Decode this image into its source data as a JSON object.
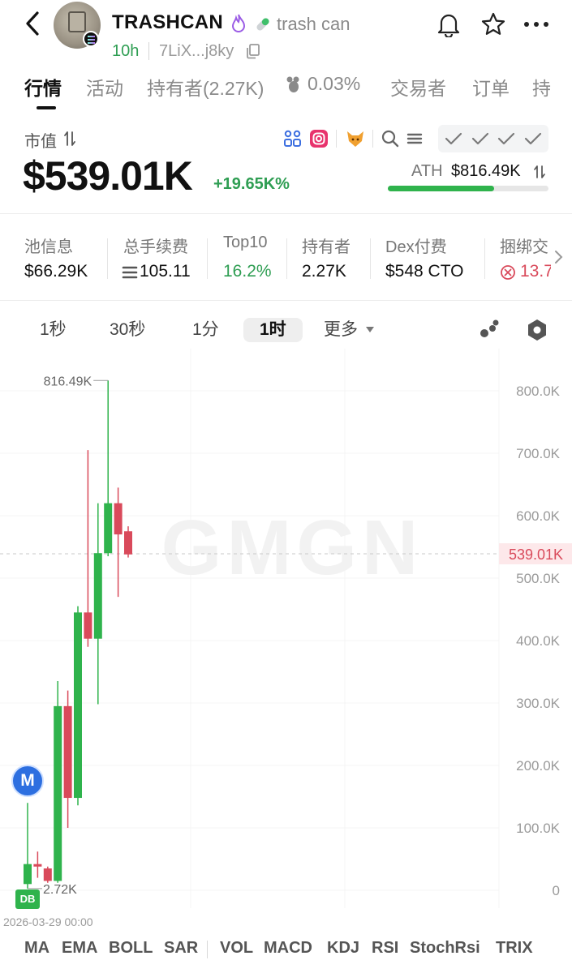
{
  "header": {
    "token_name": "TRASHCAN",
    "token_desc": "trash can",
    "age": "10h",
    "address": "7LiX...j8ky"
  },
  "tabs": [
    {
      "label": "行情",
      "active": true
    },
    {
      "label": "活动",
      "active": false
    },
    {
      "label": "持有者(2.27K)",
      "active": false
    },
    {
      "label": "0.03%",
      "active": false
    },
    {
      "label": "交易者",
      "active": false
    },
    {
      "label": "订单",
      "active": false
    },
    {
      "label": "持",
      "active": false
    }
  ],
  "market": {
    "label": "市值",
    "value": "$539.01K",
    "change": "+19.65K%",
    "ath_label": "ATH",
    "ath_value": "$816.49K",
    "ath_progress": 0.66
  },
  "stats": [
    {
      "label": "池信息",
      "value": "$66.29K"
    },
    {
      "label": "总手续费",
      "value": "105.11"
    },
    {
      "label": "Top10",
      "value": "16.2%"
    },
    {
      "label": "持有者",
      "value": "2.27K"
    },
    {
      "label": "Dex付费",
      "value": "$548 CTO"
    },
    {
      "label": "捆绑交",
      "value": "13.7"
    }
  ],
  "timeframes": {
    "t1": "1秒",
    "t2": "30秒",
    "t3": "1分",
    "t4": "1时",
    "more": "更多",
    "active": "1时"
  },
  "chart_data": {
    "type": "candlestick",
    "y_ticks": [
      "800.0K",
      "700.0K",
      "600.0K",
      "500.0K",
      "400.0K",
      "300.0K",
      "200.0K",
      "100.0K",
      "0"
    ],
    "ylim": [
      0,
      860000
    ],
    "current_price_label": "539.01K",
    "current_price": 539010,
    "high_label": "816.49K",
    "low_label": "2.72K",
    "x_start_label": "2026-03-29 00:00",
    "watermark": "GMGN",
    "candles": [
      {
        "open": 10000,
        "close": 42000,
        "high": 140000,
        "low": 2720
      },
      {
        "open": 42000,
        "close": 38000,
        "high": 62000,
        "low": 20000
      },
      {
        "open": 35000,
        "close": 15000,
        "high": 38000,
        "low": 12000
      },
      {
        "open": 15000,
        "close": 295000,
        "high": 335000,
        "low": 12000
      },
      {
        "open": 295000,
        "close": 148000,
        "high": 320000,
        "low": 100000
      },
      {
        "open": 148000,
        "close": 445000,
        "high": 455000,
        "low": 136000
      },
      {
        "open": 445000,
        "close": 403000,
        "high": 705000,
        "low": 390000
      },
      {
        "open": 403000,
        "close": 540000,
        "high": 620000,
        "low": 298000
      },
      {
        "open": 540000,
        "close": 620000,
        "high": 816490,
        "low": 535000
      },
      {
        "open": 620000,
        "close": 570000,
        "high": 645000,
        "low": 470000
      },
      {
        "open": 575000,
        "close": 538000,
        "high": 583000,
        "low": 533000
      }
    ]
  },
  "badges": {
    "m": "M",
    "db": "DB"
  },
  "indicators": [
    "MA",
    "EMA",
    "BOLL",
    "SAR",
    "VOL",
    "MACD",
    "KDJ",
    "RSI",
    "StochRsi",
    "TRIX"
  ],
  "colors": {
    "up": "#2fb34c",
    "down": "#d94a5b",
    "accent": "#2f9e53"
  }
}
